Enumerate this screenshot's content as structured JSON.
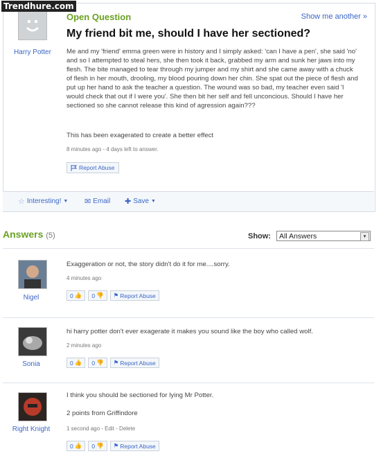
{
  "watermark": "Trendhure.com",
  "question": {
    "status": "Open Question",
    "show_another": "Show me another »",
    "title": "My friend bit me, should I have her sectioned?",
    "asker": "Harry Potter",
    "body": "Me and my 'friend' emma green were in history and I simply asked: 'can I have a pen', she said 'no' and so I attempted to steal hers, she then took it back, grabbed my arm and sunk her jaws into my flesh. The bite managed to tear through my jumper and my shirt and she came away with a chuck of flesh in her mouth, drooling, my blood pouring down her chin. She spat out the piece of flesh and put up her hand to ask the teacher a question. The wound was so bad, my teacher even said 'I would check that out if I were you'. She then bit her self and fell unconcious. Should I have her sectioned so she cannot release this kind of agression again???",
    "note": "This has been exagerated to create a better effect",
    "meta": "8 minutes ago - 4 days left to answer.",
    "report": "Report Abuse",
    "actions": {
      "interesting": "Interesting!",
      "email": "Email",
      "save": "Save"
    }
  },
  "answers_header": {
    "label": "Answers",
    "count": "(5)",
    "show_label": "Show:",
    "show_value": "All Answers"
  },
  "answers": [
    {
      "name": "Nigel",
      "text": "Exaggeration or not, the story didn't do it for me....sorry.",
      "meta": "4 minutes ago",
      "up": "0",
      "down": "0",
      "report": "Report Abuse"
    },
    {
      "name": "Sonia",
      "text": "hi harry potter don't ever exagerate it makes you sound like the boy who called wolf.",
      "meta": "2 minutes ago",
      "up": "0",
      "down": "0",
      "report": "Report Abuse"
    },
    {
      "name": "Right Knight",
      "text": "I think you should be sectioned for lying Mr Potter.",
      "extra": "2 points from Griffindore",
      "meta": "1 second ago - Edit - Delete",
      "up": "0",
      "down": "0",
      "report": "Report Abuse"
    }
  ]
}
